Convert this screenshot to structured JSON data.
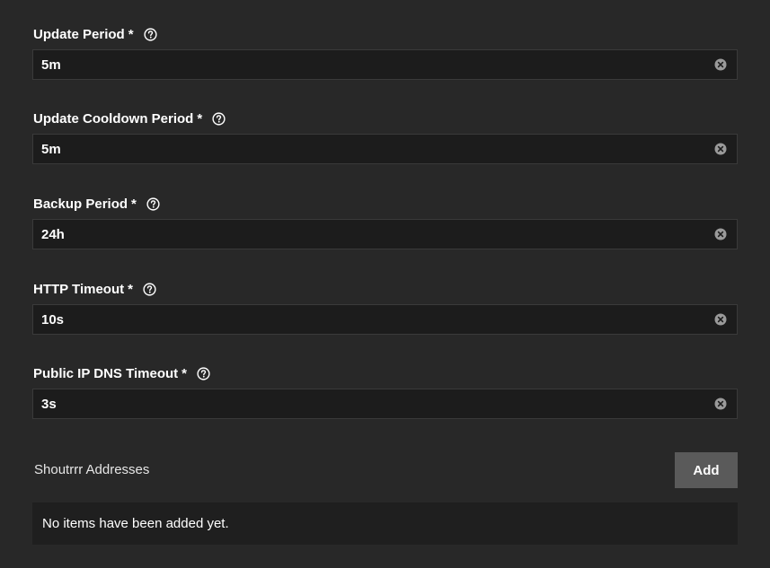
{
  "fields": [
    {
      "label": "Update Period",
      "required": "*",
      "value": "5m",
      "help_icon": "question-circle-icon",
      "clear_icon": "clear-circle-icon"
    },
    {
      "label": "Update Cooldown Period",
      "required": "*",
      "value": "5m",
      "help_icon": "question-circle-icon",
      "clear_icon": "clear-circle-icon"
    },
    {
      "label": "Backup Period",
      "required": "*",
      "value": "24h",
      "help_icon": "question-circle-icon",
      "clear_icon": "clear-circle-icon"
    },
    {
      "label": "HTTP Timeout",
      "required": "*",
      "value": "10s",
      "help_icon": "question-circle-icon",
      "clear_icon": "clear-circle-icon"
    },
    {
      "label": "Public IP DNS Timeout",
      "required": "*",
      "value": "3s",
      "help_icon": "question-circle-icon",
      "clear_icon": "clear-circle-icon"
    }
  ],
  "shoutrrr": {
    "title": "Shoutrrr Addresses",
    "add_label": "Add",
    "empty_text": "No items have been added yet."
  },
  "colors": {
    "background": "#282828",
    "input_background": "#1c1c1c",
    "button_background": "#5a5a5a"
  }
}
